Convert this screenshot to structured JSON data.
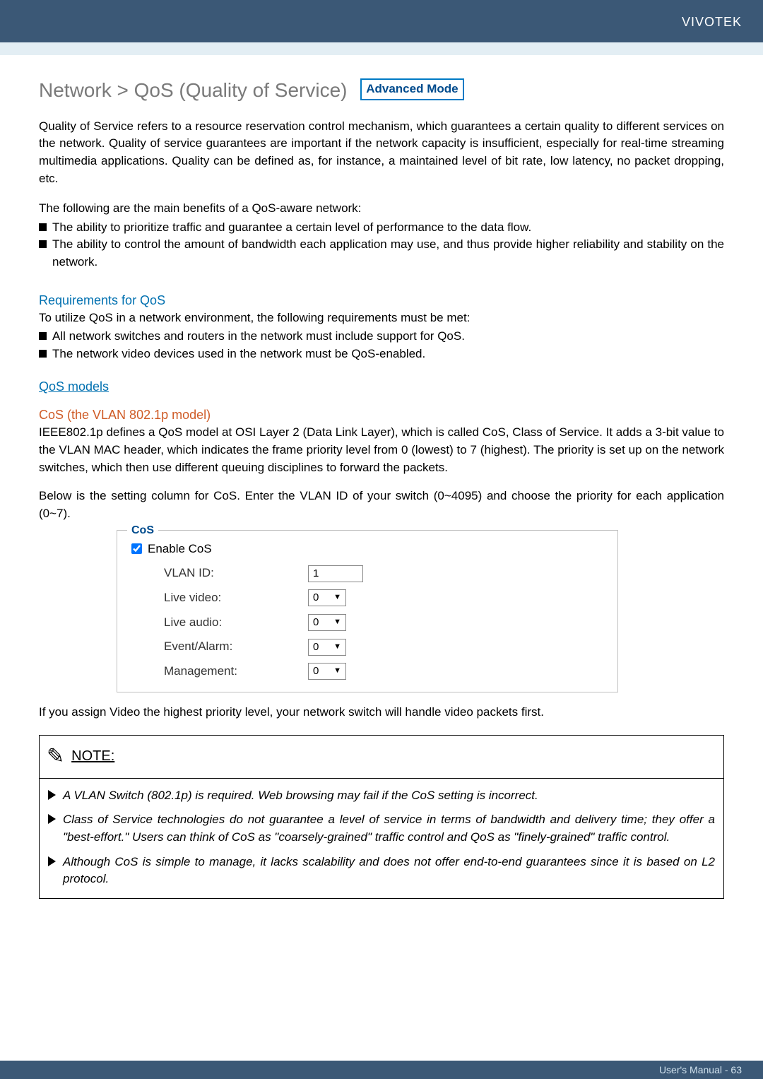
{
  "header": {
    "brand": "VIVOTEK"
  },
  "title": "Network > QoS (Quality of Service)",
  "advanced_badge": "Advanced Mode",
  "intro": "Quality of Service refers to a resource reservation control mechanism, which guarantees a certain quality to different services on the network. Quality of service guarantees are important if the network capacity is insufficient, especially for real-time streaming multimedia applications. Quality can be defined as, for instance, a maintained level of bit rate, low latency, no packet dropping, etc.",
  "benefits_lead": "The following are the main benefits of a QoS-aware network:",
  "benefits": [
    "The ability to prioritize traffic and guarantee a certain level of performance to the data flow.",
    "The ability to control the amount of bandwidth each application may use, and thus provide higher reliability and stability on the network."
  ],
  "req_header": "Requirements for QoS",
  "req_lead": "To utilize QoS in a network environment, the following requirements must be met:",
  "req_items": [
    "All network switches and routers in the network must include support for QoS.",
    "The network video devices used in the network must be QoS-enabled."
  ],
  "models_header": "QoS models",
  "cos_header": "CoS (the VLAN 802.1p model)",
  "cos_para1": "IEEE802.1p defines a QoS model at OSI Layer 2 (Data Link Layer), which is called CoS, Class of Service. It adds a 3-bit value to the VLAN MAC header, which indicates the frame priority level from 0 (lowest) to 7 (highest). The priority is set up on the network switches, which then use different queuing disciplines to forward the packets.",
  "cos_para2": "Below is the setting column for CoS. Enter the VLAN ID of your switch (0~4095) and choose the priority for each application (0~7).",
  "cos_panel": {
    "legend": "CoS",
    "enable_label": "Enable CoS",
    "enable_checked": true,
    "rows": {
      "vlan": {
        "label": "VLAN ID:",
        "value": "1"
      },
      "video": {
        "label": "Live video:",
        "value": "0"
      },
      "audio": {
        "label": "Live audio:",
        "value": "0"
      },
      "event": {
        "label": "Event/Alarm:",
        "value": "0"
      },
      "mgmt": {
        "label": "Management:",
        "value": "0"
      }
    }
  },
  "post_panel": "If you assign Video the highest priority level, your network switch will handle video packets first.",
  "note": {
    "title": "NOTE:",
    "items": [
      "A VLAN Switch (802.1p) is required. Web browsing may fail if the CoS setting is incorrect.",
      "Class of Service technologies do not guarantee a level of service in terms of bandwidth and delivery time; they offer a \"best-effort.\" Users can think of CoS as \"coarsely-grained\" traffic control and QoS as \"finely-grained\" traffic control.",
      "Although CoS is simple to manage, it lacks scalability and does not offer end-to-end guarantees since it is based on L2 protocol."
    ]
  },
  "footer": "User's Manual - 63"
}
